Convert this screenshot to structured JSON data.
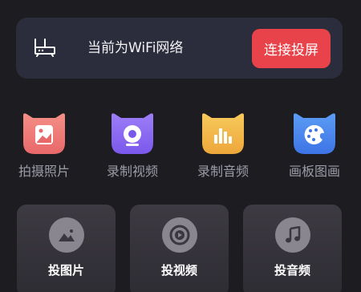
{
  "wifi_banner": {
    "network_text": "当前为WiFi网络",
    "cast_button_label": "连接投屏"
  },
  "tools": [
    {
      "label": "拍摄照片",
      "icon": "photo-icon",
      "color": "#f07e7a"
    },
    {
      "label": "录制视频",
      "icon": "camera-icon",
      "color": "#8f6df2"
    },
    {
      "label": "录制音频",
      "icon": "audio-bars-icon",
      "color": "#f2b84d"
    },
    {
      "label": "画板图画",
      "icon": "palette-icon",
      "color": "#4d8cf2"
    }
  ],
  "cast_cards": [
    {
      "label": "投图片",
      "icon": "image-icon"
    },
    {
      "label": "投视频",
      "icon": "video-disc-icon"
    },
    {
      "label": "投音频",
      "icon": "music-note-icon"
    }
  ],
  "colors": {
    "background": "#1c1c21",
    "card": "#2c2d3c",
    "accent": "#e8434a"
  }
}
